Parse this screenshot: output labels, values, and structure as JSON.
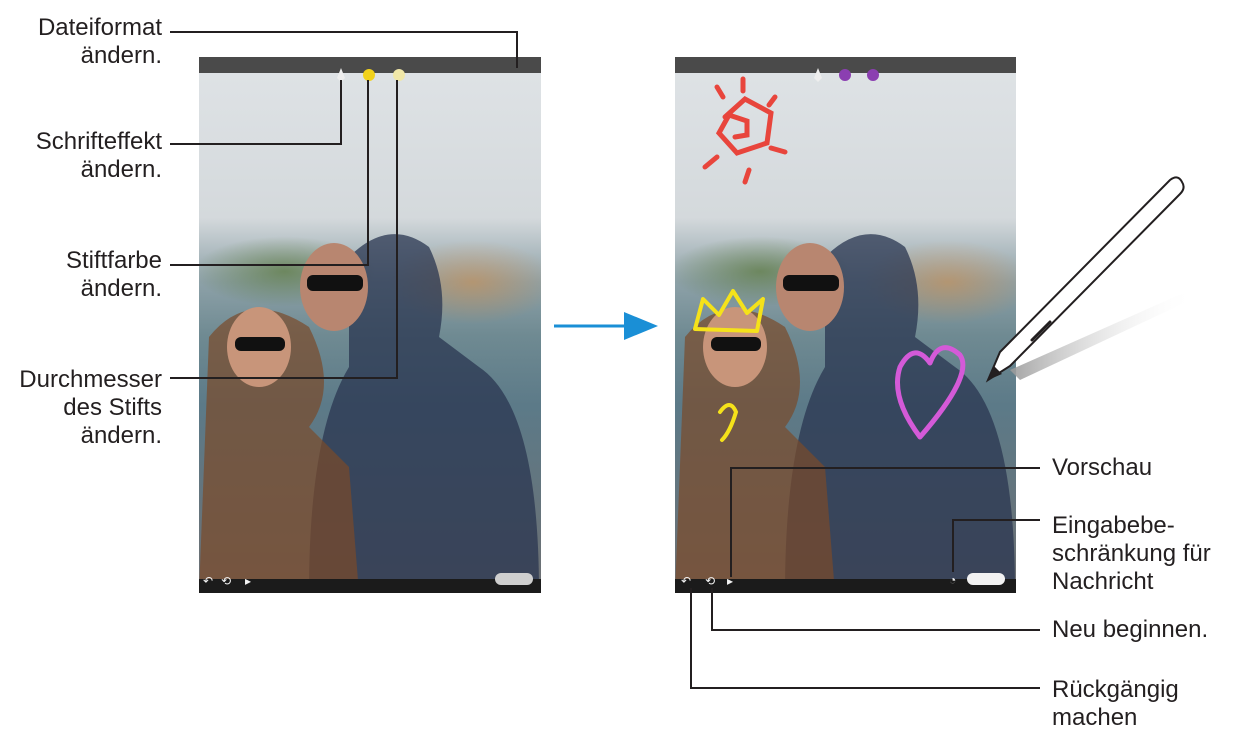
{
  "labels": {
    "file_format": [
      "Dateiformat",
      "ändern."
    ],
    "font_effect": [
      "Schrifteffekt",
      "ändern."
    ],
    "pen_color": [
      "Stiftfarbe",
      "ändern."
    ],
    "pen_size": [
      "Durchmesser",
      "des Stifts",
      "ändern."
    ],
    "preview": [
      "Vorschau"
    ],
    "input_limit": [
      "Eingabebe-",
      "schränkung für",
      "Nachricht"
    ],
    "restart": [
      "Neu beginnen."
    ],
    "undo": [
      "Rückgängig",
      "machen"
    ]
  },
  "colors": {
    "callout_line": "#231f20",
    "arrow": "#1a8fd6",
    "pen_color_yellow": "#f2d21b",
    "pen_color_purple": "#8b3fb1",
    "drawing_sun": "#e8453c",
    "drawing_crown": "#f5e21a",
    "drawing_heart": "#d45ad8"
  },
  "icons": {
    "pen_type": "pen-icon",
    "undo": "undo-icon",
    "restart": "restart-icon",
    "preview": "play-icon",
    "input_limit": "timer-icon",
    "send": "send-button",
    "s_pen": "s-pen-icon"
  }
}
